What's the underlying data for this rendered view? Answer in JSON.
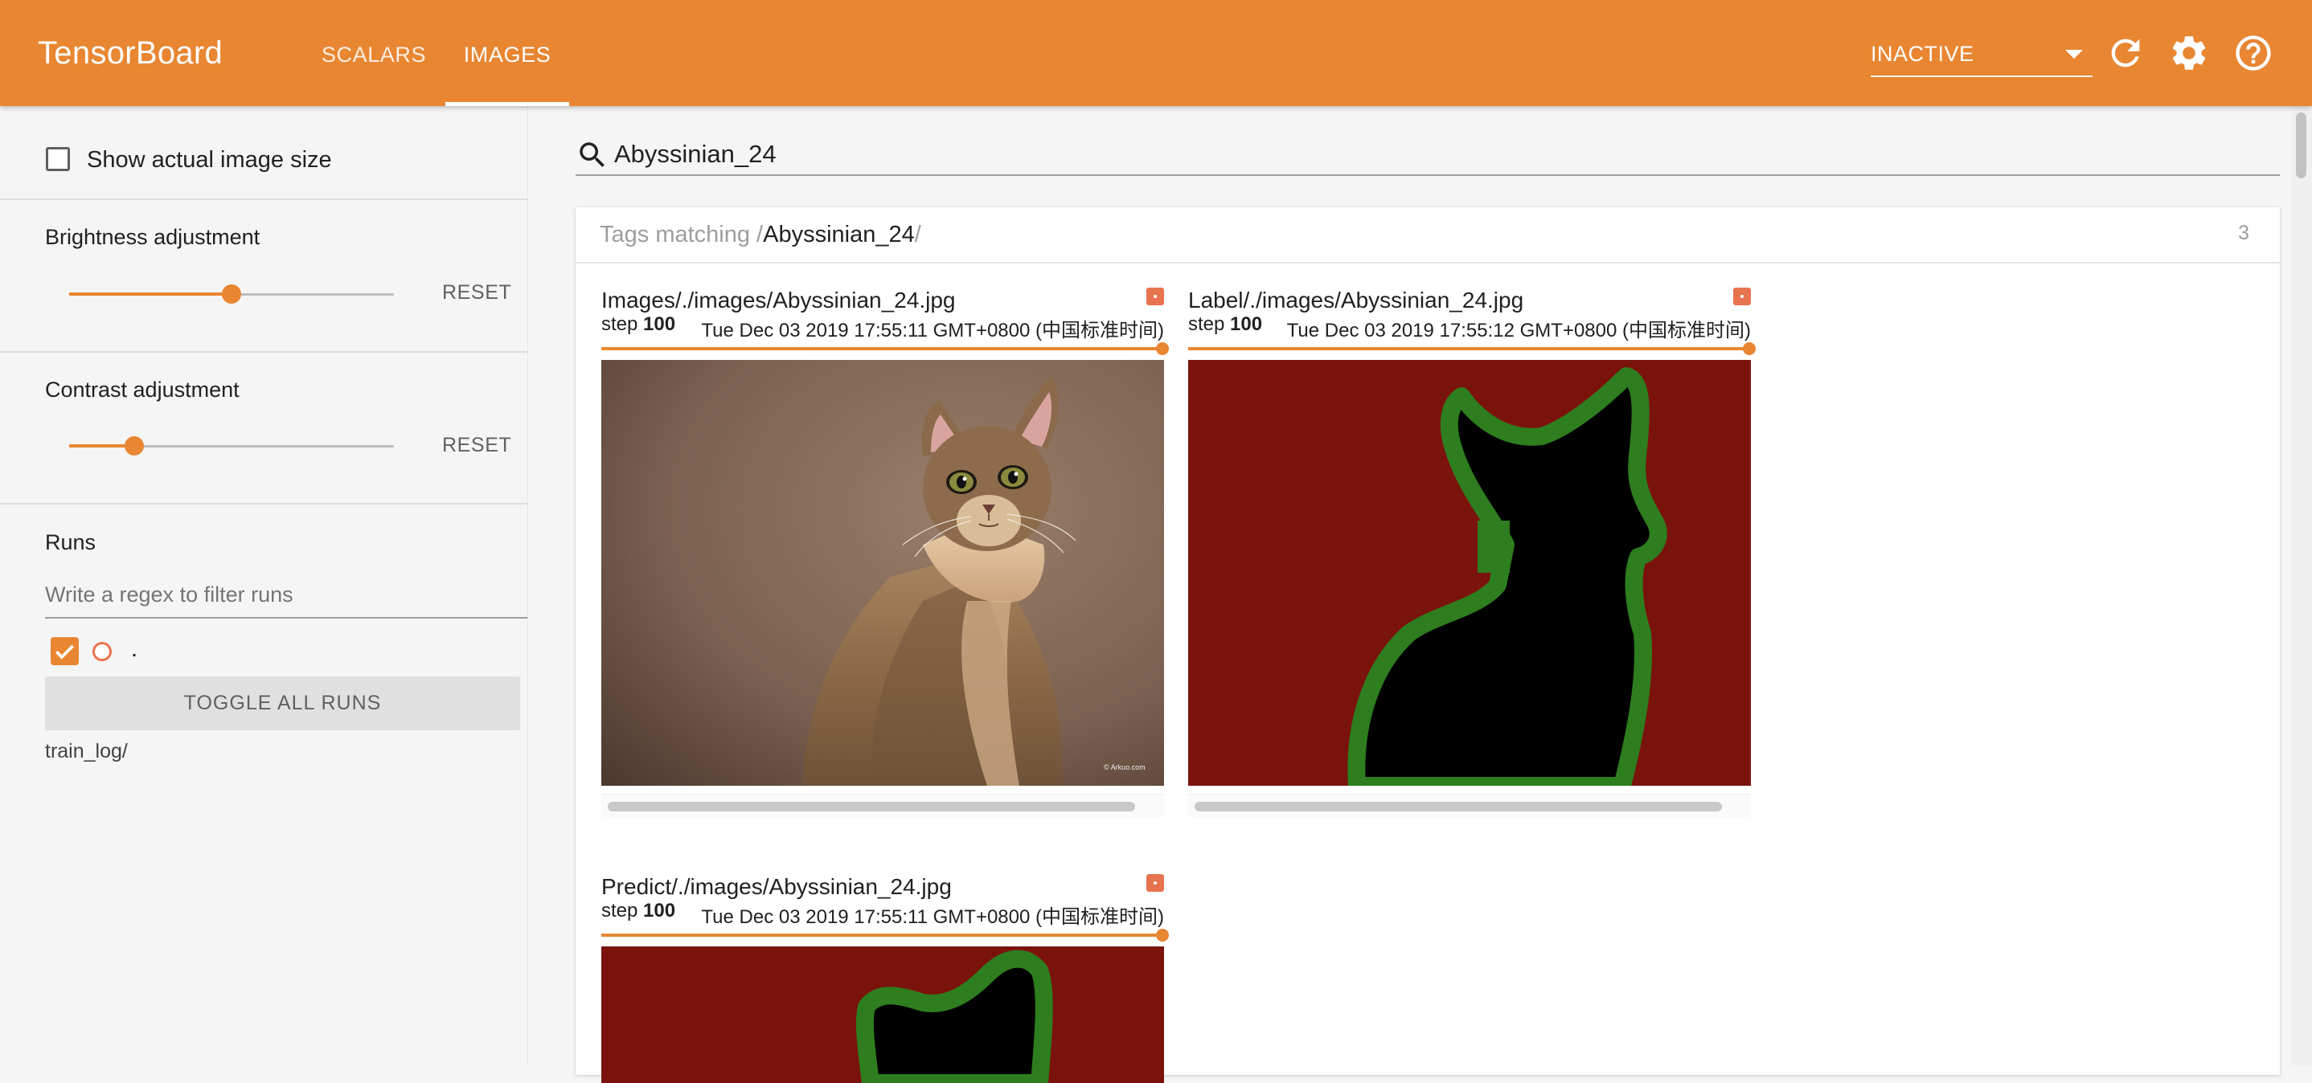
{
  "header": {
    "app_title": "TensorBoard",
    "tabs": [
      {
        "label": "SCALARS",
        "active": false
      },
      {
        "label": "IMAGES",
        "active": true
      }
    ],
    "status_select": {
      "value": "INACTIVE"
    },
    "icons": [
      "refresh-icon",
      "settings-icon",
      "help-icon"
    ],
    "accent_color": "#e88632"
  },
  "sidebar": {
    "show_actual_size": {
      "label": "Show actual image size",
      "checked": false
    },
    "brightness": {
      "label": "Brightness adjustment",
      "reset_label": "RESET",
      "level": 0.5
    },
    "contrast": {
      "label": "Contrast adjustment",
      "reset_label": "RESET",
      "level": 0.2
    },
    "runs": {
      "title": "Runs",
      "filter_placeholder": "Write a regex to filter runs",
      "items": [
        {
          "name": ".",
          "checked": true
        }
      ],
      "toggle_label": "TOGGLE ALL RUNS",
      "directory": "train_log/"
    }
  },
  "main": {
    "search": {
      "value": "Abyssinian_24"
    },
    "tag_group": {
      "prefix": "Tags matching /",
      "pattern": "Abyssinian_24",
      "suffix": "/",
      "count": "3"
    },
    "panes": [
      {
        "title": "Images/./images/Abyssinian_24.jpg",
        "step_label": "step",
        "step": "100",
        "time": "Tue Dec 03 2019 17:55:11 GMT+0800 (中国标准时间)"
      },
      {
        "title": "Label/./images/Abyssinian_24.jpg",
        "step_label": "step",
        "step": "100",
        "time": "Tue Dec 03 2019 17:55:12 GMT+0800 (中国标准时间)"
      },
      {
        "title": "Predict/./images/Abyssinian_24.jpg",
        "step_label": "step",
        "step": "100",
        "time": "Tue Dec 03 2019 17:55:11 GMT+0800 (中国标准时间)"
      }
    ],
    "photo_watermark": "© Arkuo.com"
  }
}
